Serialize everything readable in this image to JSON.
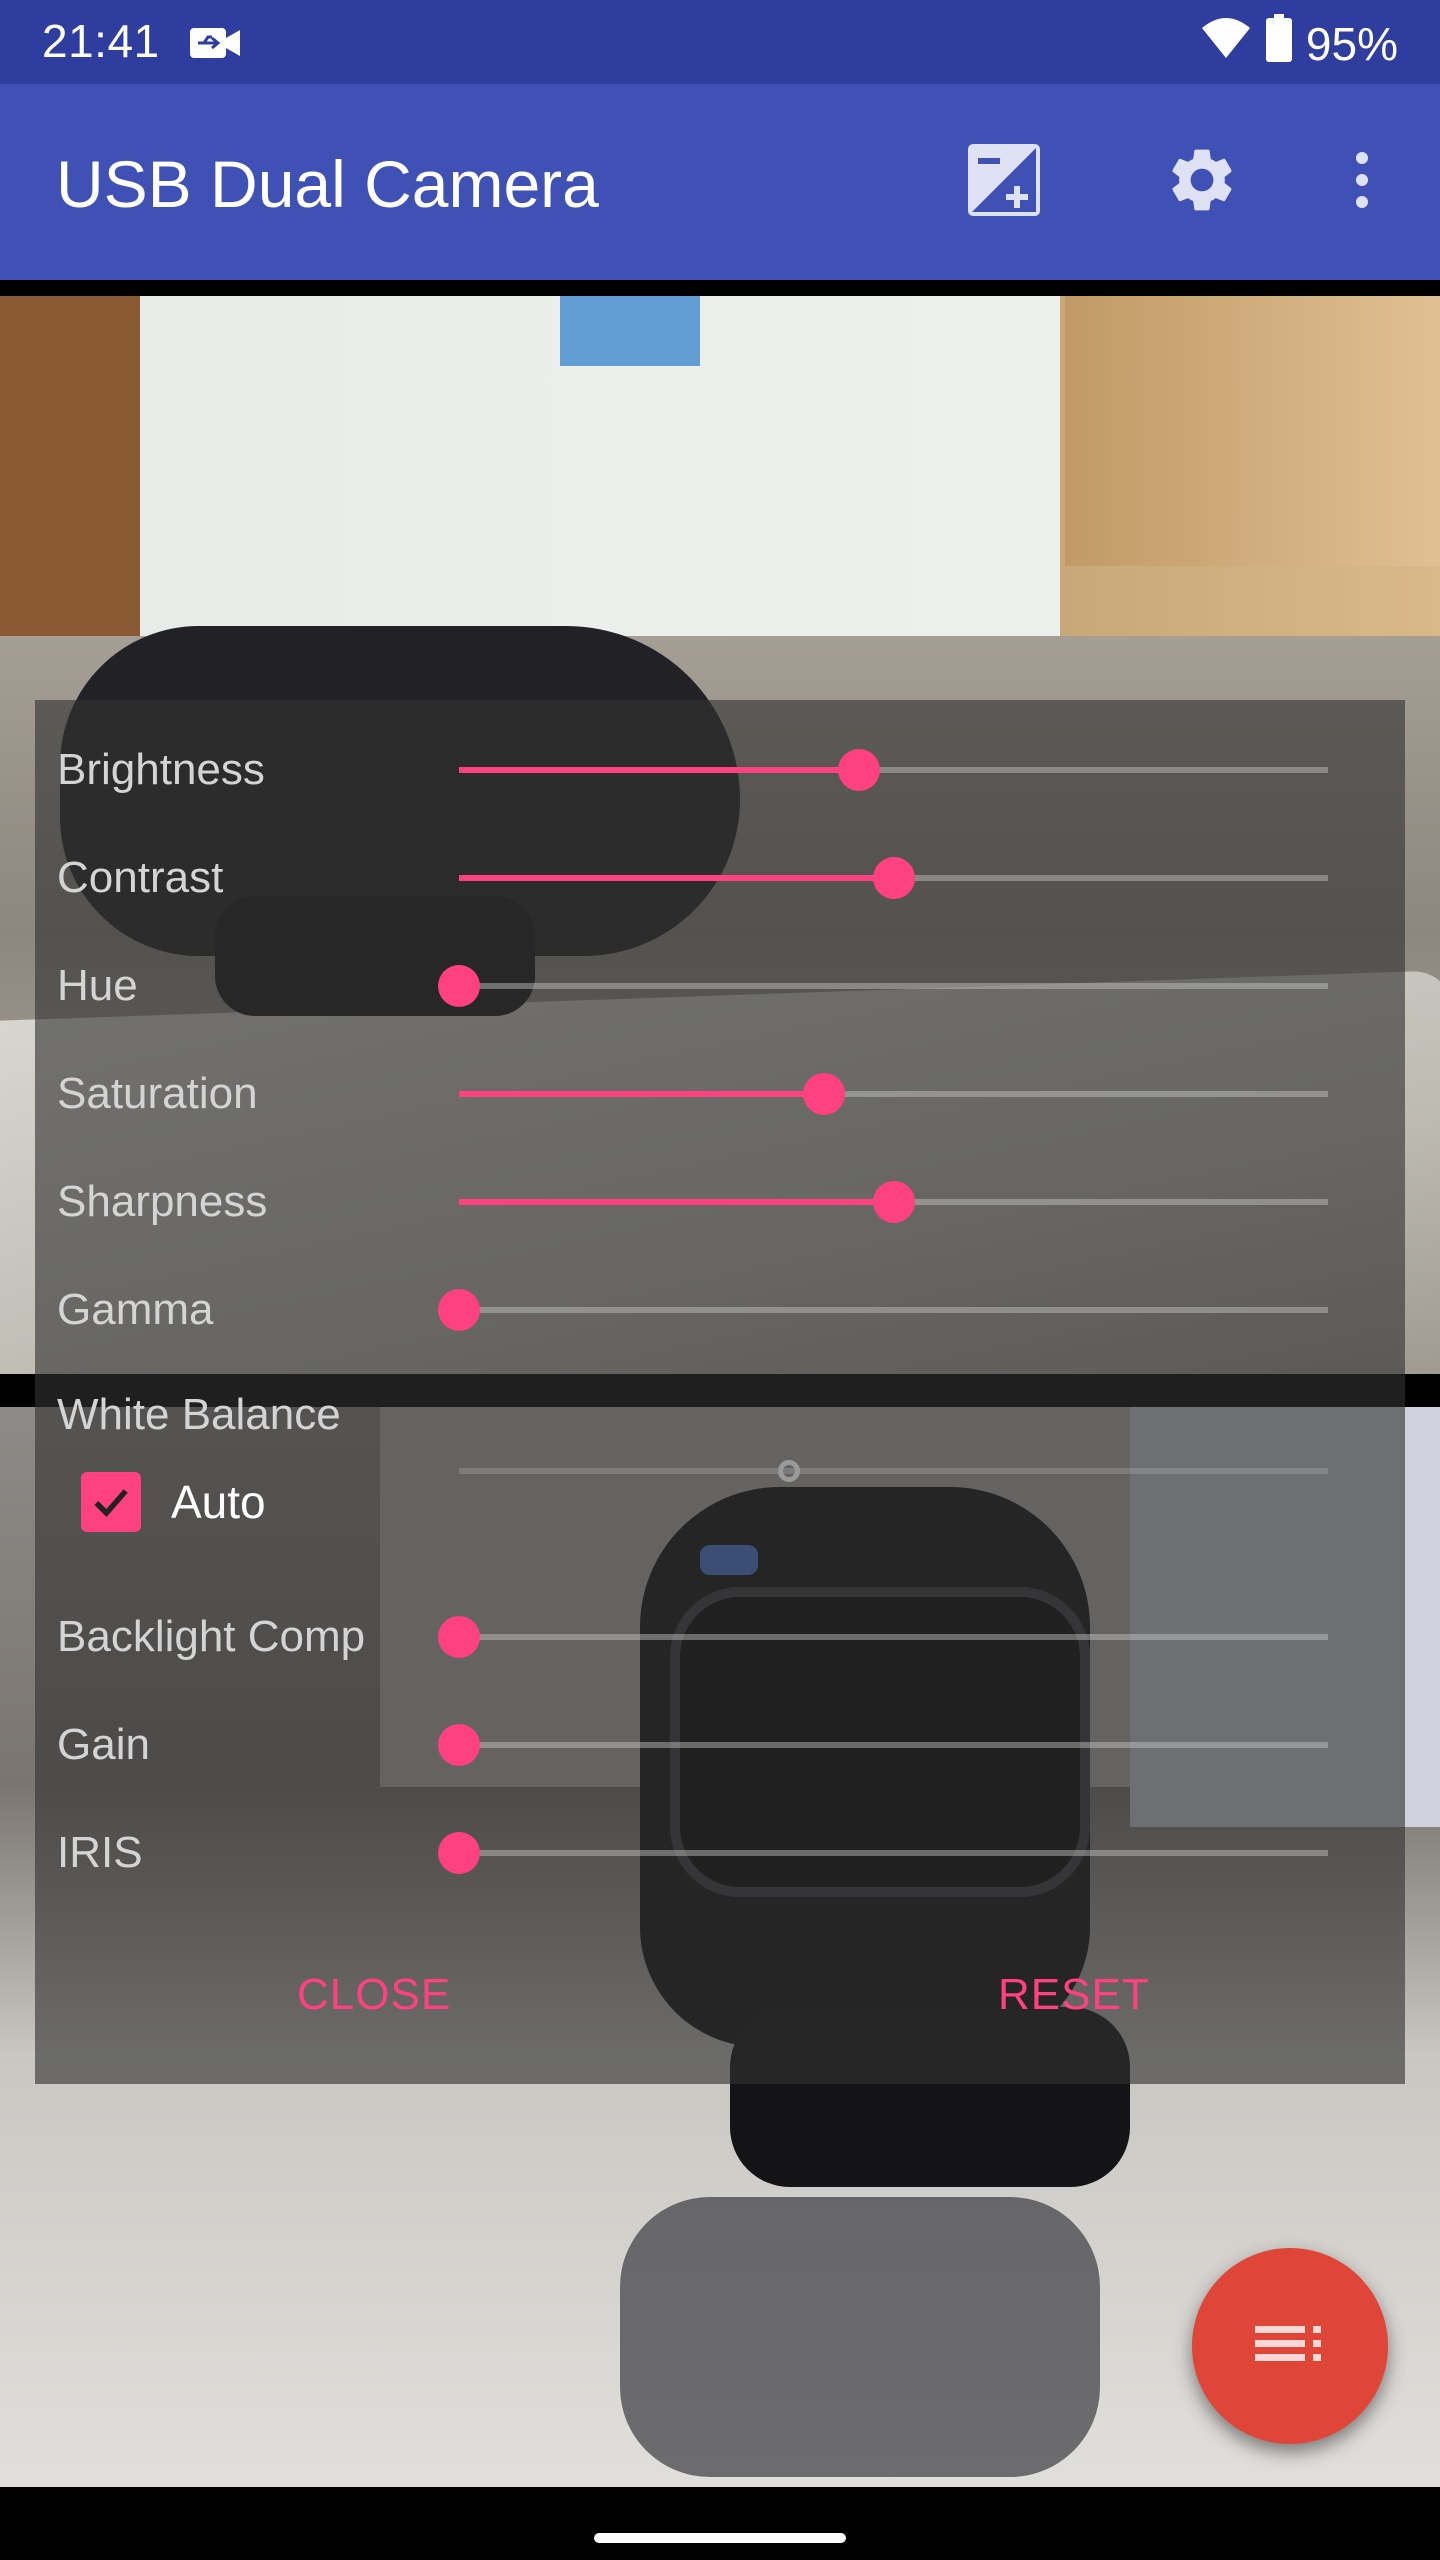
{
  "status_bar": {
    "time": "21:41",
    "notification_icon": "usb-camera-icon",
    "wifi_icon": "wifi-icon",
    "battery_icon": "battery-icon",
    "battery_percent": "95%"
  },
  "app_bar": {
    "title": "USB Dual Camera",
    "actions": [
      {
        "name": "exposure-icon",
        "label": "Exposure"
      },
      {
        "name": "settings-icon",
        "label": "Settings"
      },
      {
        "name": "more-options-icon",
        "label": "More options"
      }
    ]
  },
  "controls_panel": {
    "sliders_top": [
      {
        "label": "Brightness",
        "value": 0.46,
        "enabled": true
      },
      {
        "label": "Contrast",
        "value": 0.5,
        "enabled": true
      },
      {
        "label": "Hue",
        "value": 0.0,
        "enabled": true
      },
      {
        "label": "Saturation",
        "value": 0.42,
        "enabled": true
      },
      {
        "label": "Sharpness",
        "value": 0.5,
        "enabled": true
      },
      {
        "label": "Gamma",
        "value": 0.0,
        "enabled": true
      }
    ],
    "white_balance": {
      "label": "White Balance",
      "value": 0.38,
      "enabled": false,
      "auto_label": "Auto",
      "auto_checked": true
    },
    "sliders_bottom": [
      {
        "label": "Backlight Comp",
        "value": 0.0,
        "enabled": true
      },
      {
        "label": "Gain",
        "value": 0.0,
        "enabled": true
      },
      {
        "label": "IRIS",
        "value": 0.0,
        "enabled": true
      }
    ],
    "close_label": "CLOSE",
    "reset_label": "RESET"
  },
  "fab": {
    "icon": "list-menu-icon"
  },
  "colors": {
    "status_bar": "#2f3e9e",
    "app_bar": "#3f51b5",
    "accent": "#ff4081",
    "fab": "#e04638"
  }
}
